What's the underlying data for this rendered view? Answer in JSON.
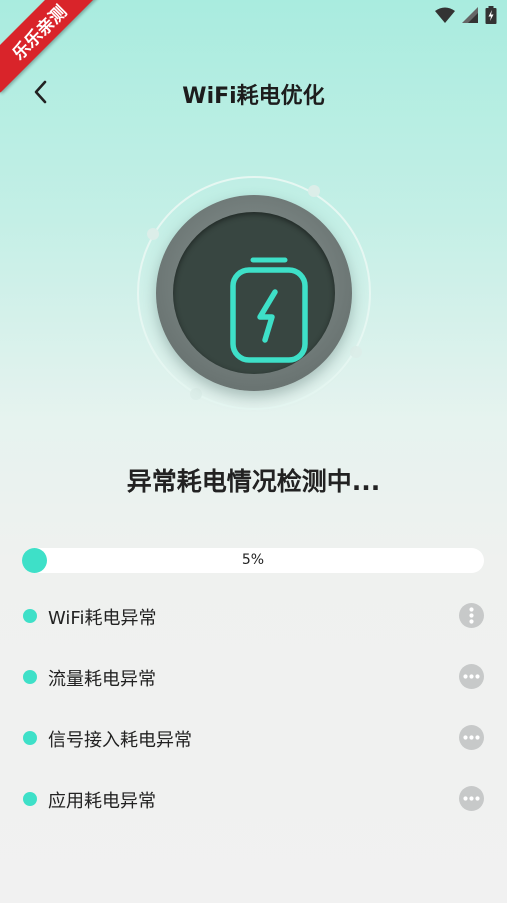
{
  "watermark": {
    "text": "乐乐亲测"
  },
  "header": {
    "title": "WiFi耗电优化",
    "back_icon": "chevron-left-icon"
  },
  "scan": {
    "status_text": "异常耗电情况检测中...",
    "progress_label": "5%",
    "progress_value": 0.05
  },
  "checks": [
    {
      "label": "WiFi耗电异常",
      "state": "loading"
    },
    {
      "label": "流量耗电异常",
      "state": "pending"
    },
    {
      "label": "信号接入耗电异常",
      "state": "pending"
    },
    {
      "label": "应用耗电异常",
      "state": "pending"
    }
  ],
  "colors": {
    "accent": "#3ee0c8",
    "knob_dark": "#384641",
    "watermark_red": "#d9242a"
  }
}
